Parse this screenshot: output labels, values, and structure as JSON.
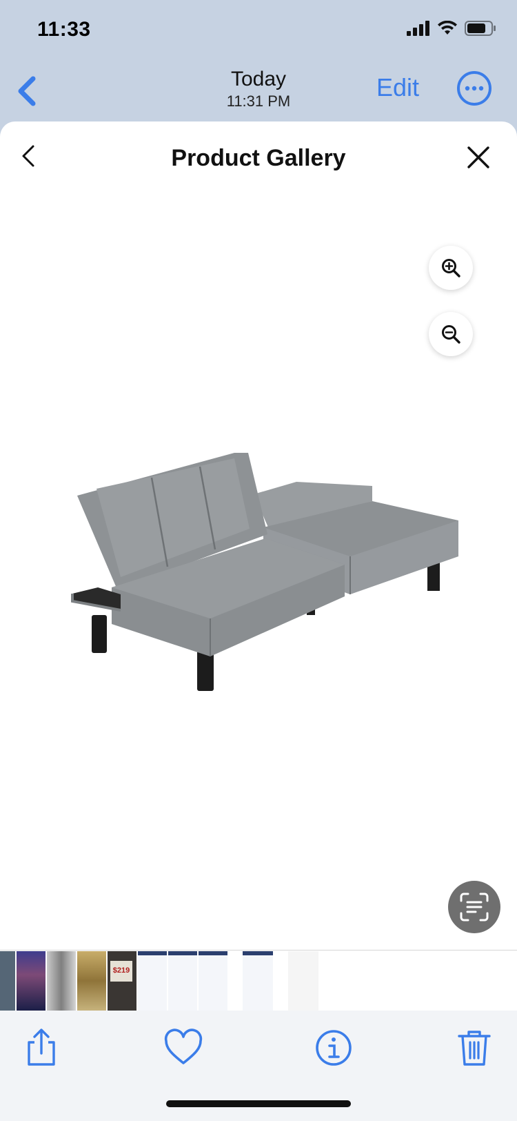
{
  "status_bar": {
    "time": "11:33"
  },
  "nav": {
    "date": "Today",
    "time": "11:31 PM",
    "edit_label": "Edit"
  },
  "sheet": {
    "title": "Product Gallery"
  },
  "product": {
    "name": "grey futon sofa bed",
    "color": "#8d9194"
  },
  "thumbnails": [
    {
      "label": "",
      "color": "#556676"
    },
    {
      "label": "",
      "color": "#5a4fa0"
    },
    {
      "label": "",
      "color": "#9a9a9a"
    },
    {
      "label": "",
      "color": "#b39a5d"
    },
    {
      "label": "$219",
      "color": "#3a3633"
    },
    {
      "label": "",
      "color": "#e8eef6"
    },
    {
      "label": "",
      "color": "#e8eef6"
    },
    {
      "label": "",
      "color": "#e8eef6"
    },
    {
      "label": "",
      "color": "#e8eef6"
    },
    {
      "label": "",
      "color": "#f4f4f4"
    }
  ],
  "colors": {
    "accent": "#3b7de9",
    "header_bg": "#c6d2e2"
  }
}
